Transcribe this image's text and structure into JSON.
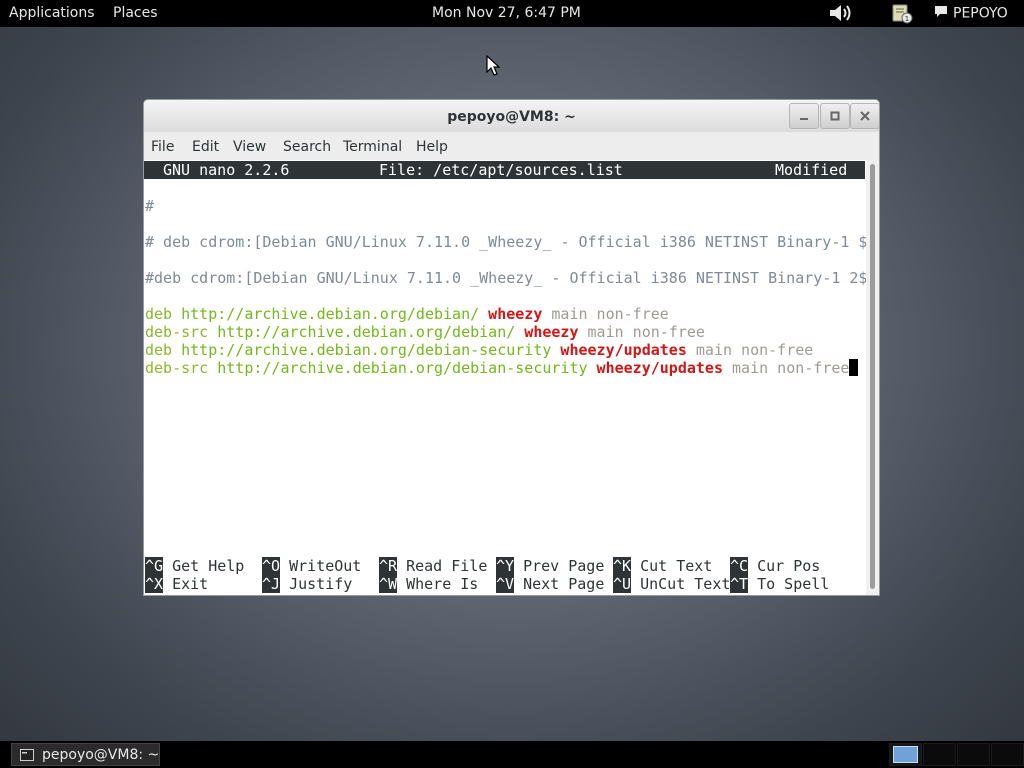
{
  "top_panel": {
    "applications": "Applications",
    "places": "Places",
    "clock": "Mon Nov 27,  6:47 PM",
    "user": "PEPOYO"
  },
  "window": {
    "title": "pepoyo@VM8: ~",
    "menu": [
      "File",
      "Edit",
      "View",
      "Search",
      "Terminal",
      "Help"
    ]
  },
  "nano": {
    "version": "GNU nano 2.2.6",
    "file": "File: /etc/apt/sources.list",
    "status": "Modified",
    "comments": [
      "#",
      "# deb cdrom:[Debian GNU/Linux 7.11.0 _Wheezy_ - Official i386 NETINST Binary-1 $",
      "#deb cdrom:[Debian GNU/Linux 7.11.0 _Wheezy_ - Official i386 NETINST Binary-1 2$"
    ],
    "sources": [
      {
        "type": "deb",
        "url": "http://archive.debian.org/debian/",
        "dist": "wheezy",
        "components": "main non-free"
      },
      {
        "type": "deb-src",
        "url": "http://archive.debian.org/debian/",
        "dist": "wheezy",
        "components": "main non-free"
      },
      {
        "type": "deb",
        "url": "http://archive.debian.org/debian-security",
        "dist": "wheezy/updates",
        "components": "main non-free"
      },
      {
        "type": "deb-src",
        "url": "http://archive.debian.org/debian-security",
        "dist": "wheezy/updates",
        "components": "main non-free"
      }
    ],
    "shortcuts_row1": [
      {
        "key": "^G",
        "label": "Get Help"
      },
      {
        "key": "^O",
        "label": "WriteOut"
      },
      {
        "key": "^R",
        "label": "Read File"
      },
      {
        "key": "^Y",
        "label": "Prev Page"
      },
      {
        "key": "^K",
        "label": "Cut Text"
      },
      {
        "key": "^C",
        "label": "Cur Pos"
      }
    ],
    "shortcuts_row2": [
      {
        "key": "^X",
        "label": "Exit"
      },
      {
        "key": "^J",
        "label": "Justify"
      },
      {
        "key": "^W",
        "label": "Where Is"
      },
      {
        "key": "^V",
        "label": "Next Page"
      },
      {
        "key": "^U",
        "label": "UnCut Text"
      },
      {
        "key": "^T",
        "label": "To Spell"
      }
    ]
  },
  "taskbar": {
    "task_label": "pepoyo@VM8: ~"
  }
}
